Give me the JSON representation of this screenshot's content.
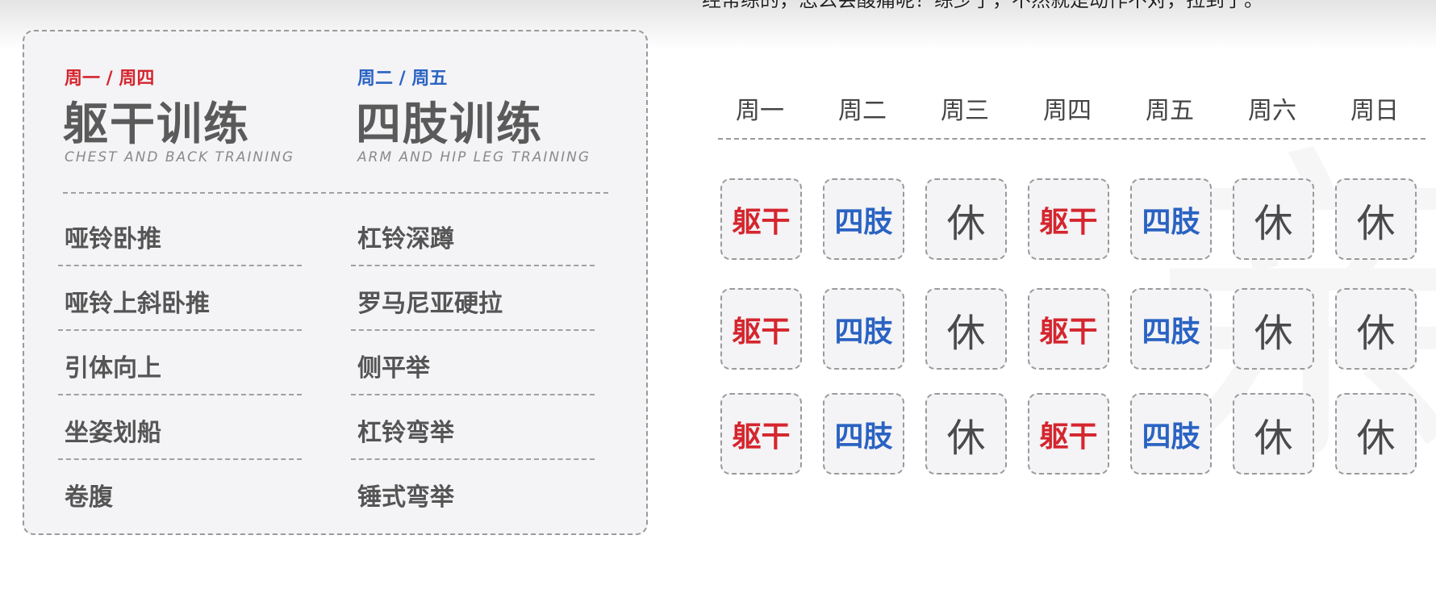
{
  "subtitle_caption": "经常练的，怎么会酸痛呢？练少了，不然就是动作不对，拉到了。",
  "background_glyph": "亲",
  "colors": {
    "torso": "#d4262e",
    "limbs": "#2a63c2",
    "rest": "#4a4a4a"
  },
  "left_plan": {
    "days": "周一 / 周四",
    "title": "躯干训练",
    "subtitle_en": "CHEST AND BACK TRAINING",
    "exercises": [
      "哑铃卧推",
      "哑铃上斜卧推",
      "引体向上",
      "坐姿划船",
      "卷腹"
    ]
  },
  "right_plan": {
    "days": "周二 / 周五",
    "title": "四肢训练",
    "subtitle_en": "ARM AND HIP LEG TRAINING",
    "exercises": [
      "杠铃深蹲",
      "罗马尼亚硬拉",
      "侧平举",
      "杠铃弯举",
      "锤式弯举"
    ]
  },
  "schedule": {
    "weekdays": [
      "周一",
      "周二",
      "周三",
      "周四",
      "周五",
      "周六",
      "周日"
    ],
    "rows": [
      [
        "躯干",
        "四肢",
        "休",
        "躯干",
        "四肢",
        "休",
        "休"
      ],
      [
        "躯干",
        "四肢",
        "休",
        "躯干",
        "四肢",
        "休",
        "休"
      ],
      [
        "躯干",
        "四肢",
        "休",
        "躯干",
        "四肢",
        "休",
        "休"
      ]
    ],
    "cell_types": [
      "torso",
      "limbs",
      "rest",
      "torso",
      "limbs",
      "rest",
      "rest"
    ]
  }
}
